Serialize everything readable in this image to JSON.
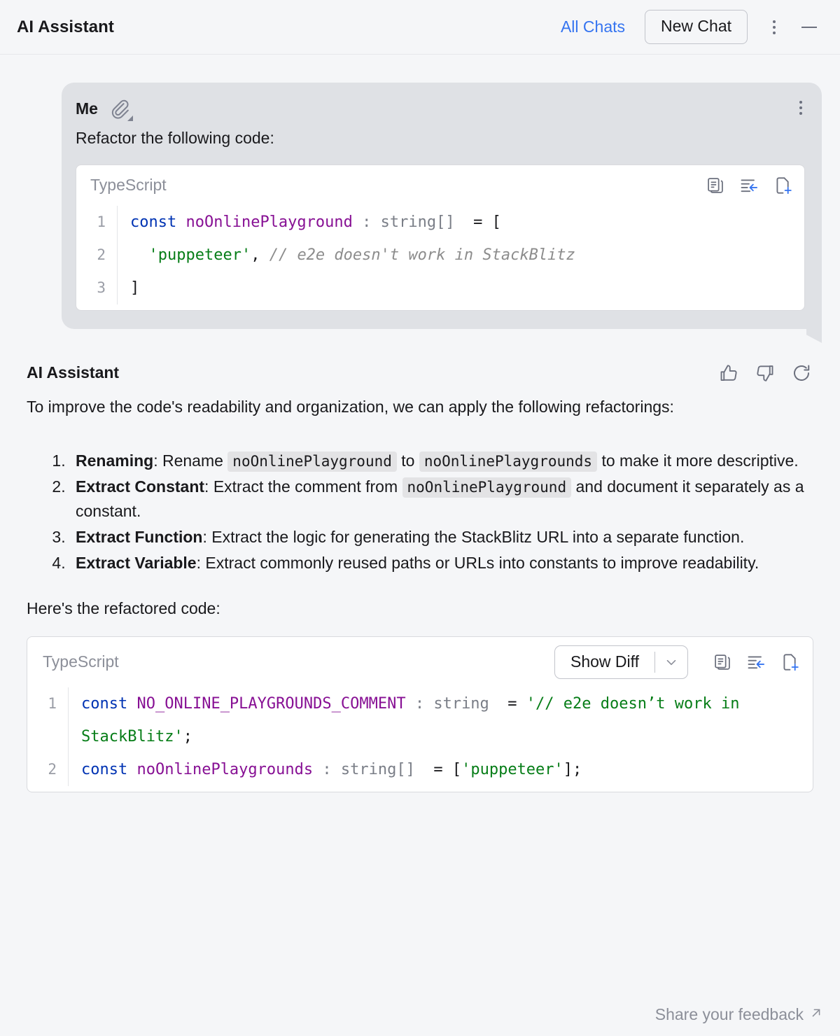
{
  "window": {
    "title": "AI Assistant",
    "all_chats_label": "All Chats",
    "new_chat_label": "New Chat",
    "more_options_icon": "kebab-menu-icon",
    "minimize_icon": "minimize-icon"
  },
  "user_message": {
    "author": "Me",
    "attachment_icon": "paperclip-icon",
    "more_icon": "kebab-menu-icon",
    "text": "Refactor the following code:",
    "code_block": {
      "language": "TypeScript",
      "actions": [
        {
          "icon": "copy-icon",
          "label": "Copy"
        },
        {
          "icon": "insert-into-editor-icon",
          "label": "Insert into editor"
        },
        {
          "icon": "new-file-icon",
          "label": "Create new file"
        }
      ],
      "lines": [
        {
          "number": "1",
          "tokens": [
            {
              "t": "const ",
              "c": "kw"
            },
            {
              "t": "noOnlinePlayground",
              "c": "var"
            },
            {
              "t": " : string[]",
              "c": "typ"
            },
            {
              "t": "  = [",
              "c": "pl"
            }
          ]
        },
        {
          "number": "2",
          "tokens": [
            {
              "t": "  'puppeteer'",
              "c": "str"
            },
            {
              "t": ", ",
              "c": "pl"
            },
            {
              "t": "// e2e doesn't work in StackBlitz",
              "c": "cmt"
            }
          ]
        },
        {
          "number": "3",
          "tokens": [
            {
              "t": "]",
              "c": "pl"
            }
          ]
        }
      ]
    }
  },
  "assistant_message": {
    "author": "AI Assistant",
    "actions": [
      {
        "icon": "thumbs-up-icon",
        "label": "Good response"
      },
      {
        "icon": "thumbs-down-icon",
        "label": "Bad response"
      },
      {
        "icon": "regenerate-icon",
        "label": "Regenerate"
      }
    ],
    "intro": "To improve the code's readability and organization, we can apply the following refactorings:",
    "list": [
      {
        "title": "Renaming",
        "parts": [
          {
            "t": ": Rename ",
            "type": "text"
          },
          {
            "t": "noOnlinePlayground",
            "type": "code"
          },
          {
            "t": " to ",
            "type": "text"
          },
          {
            "t": "noOnlinePlaygrounds",
            "type": "code"
          },
          {
            "t": " to make it more descriptive.",
            "type": "text"
          }
        ]
      },
      {
        "title": "Extract Constant",
        "parts": [
          {
            "t": ": Extract the comment from ",
            "type": "text"
          },
          {
            "t": "noOnlinePlayground",
            "type": "code"
          },
          {
            "t": " and document it separately as a constant.",
            "type": "text"
          }
        ]
      },
      {
        "title": "Extract Function",
        "parts": [
          {
            "t": ": Extract the logic for generating the StackBlitz URL into a separate function.",
            "type": "text"
          }
        ]
      },
      {
        "title": "Extract Variable",
        "parts": [
          {
            "t": ": Extract commonly reused paths or URLs into constants to improve readability.",
            "type": "text"
          }
        ]
      }
    ],
    "outro": "Here's the refactored code:",
    "code_block": {
      "language": "TypeScript",
      "show_diff_label": "Show Diff",
      "show_diff_caret_icon": "chevron-down-icon",
      "actions": [
        {
          "icon": "copy-icon",
          "label": "Copy"
        },
        {
          "icon": "insert-into-editor-icon",
          "label": "Insert into editor"
        },
        {
          "icon": "new-file-icon",
          "label": "Create new file"
        }
      ],
      "lines": [
        {
          "number": "1",
          "tokens": [
            {
              "t": "const ",
              "c": "kw"
            },
            {
              "t": "NO_ONLINE_PLAYGROUNDS_COMMENT",
              "c": "var"
            },
            {
              "t": " : string",
              "c": "typ"
            },
            {
              "t": "  = ",
              "c": "pl"
            },
            {
              "t": "'// e2e doesn’t work in StackBlitz'",
              "c": "str"
            },
            {
              "t": ";",
              "c": "pl"
            }
          ]
        },
        {
          "number": "2",
          "tokens": [
            {
              "t": "const ",
              "c": "kw"
            },
            {
              "t": "noOnlinePlaygrounds",
              "c": "var"
            },
            {
              "t": " : string[]",
              "c": "typ"
            },
            {
              "t": "  = [",
              "c": "pl"
            },
            {
              "t": "'puppeteer'",
              "c": "str"
            },
            {
              "t": "];",
              "c": "pl"
            }
          ]
        }
      ]
    }
  },
  "footer": {
    "feedback_label": "Share your feedback",
    "feedback_icon": "external-link-arrow-icon"
  },
  "colors": {
    "page_background": "#f5f6f8",
    "bubble_background": "#dfe1e5",
    "link_blue": "#3574f0",
    "keyword_blue": "#0033b3",
    "identifier_purple": "#871094",
    "string_green": "#067d17",
    "comment_gray": "#8c8c8c",
    "muted_text": "#8c8f99"
  }
}
